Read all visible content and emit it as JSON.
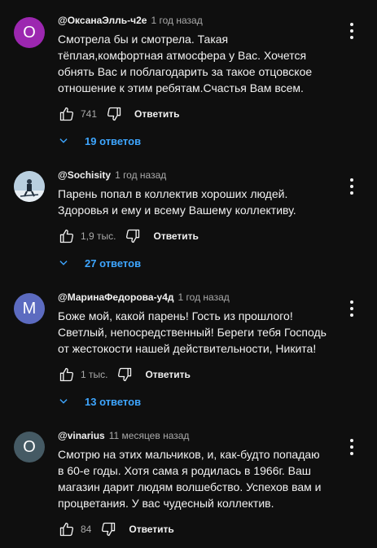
{
  "comments": [
    {
      "author": "@ОксанаЭлль-ч2е",
      "time": "1 год назад",
      "avatar_letter": "О",
      "avatar_color": "#9c27b0",
      "text": "Смотрела бы и смотрела. Такая\nтёплая,комфортная атмосфера у Вас. Хочется\nобнять  Вас  и поблагодарить за такое отцовское\nотношение к этим ребятам.Счастья Вам всем.",
      "likes": "741",
      "reply_label": "Ответить",
      "replies_label": "19 ответов"
    },
    {
      "author": "@Sochisity",
      "time": "1 год назад",
      "avatar_letter": "",
      "avatar_color": "#a9c3d6",
      "text": "Парень попал в коллектив хороших людей.\nЗдоровья и ему и всему Вашему коллективу.",
      "likes": "1,9 тыс.",
      "reply_label": "Ответить",
      "replies_label": "27 ответов"
    },
    {
      "author": "@МаринаФедорова-у4д",
      "time": "1 год назад",
      "avatar_letter": "М",
      "avatar_color": "#5c6bc0",
      "text": "Боже мой, какой парень! Гость из прошлого!\nСветлый, непосредственный! Береги тебя Господь\nот жестокости нашей действительности, Никита!",
      "likes": "1 тыс.",
      "reply_label": "Ответить",
      "replies_label": "13 ответов"
    },
    {
      "author": "@vinarius",
      "time": "11 месяцев назад",
      "avatar_letter": "O",
      "avatar_color": "#455a64",
      "text": "Смотрю на этих мальчиков, и, как-будто попадаю\nв 60-е годы. Хотя сама я родилась в 1966г.  Ваш\nмагазин дарит людям волшебство. Успехов вам и\nпроцветания. У вас чудесный коллектив.",
      "likes": "84",
      "reply_label": "Ответить"
    }
  ]
}
